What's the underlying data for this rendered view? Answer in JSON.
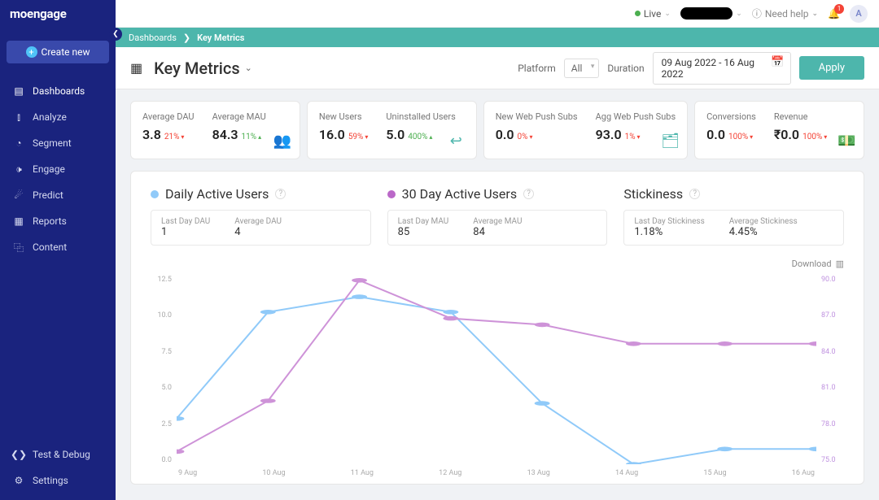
{
  "logo": "moengage",
  "create": "Create new",
  "nav": [
    {
      "icon": "▤",
      "label": "Dashboards"
    },
    {
      "icon": "⫾",
      "label": "Analyze"
    },
    {
      "icon": "◔",
      "label": "Segment"
    },
    {
      "icon": "🕩",
      "label": "Engage"
    },
    {
      "icon": "☄",
      "label": "Predict"
    },
    {
      "icon": "▦",
      "label": "Reports"
    },
    {
      "icon": "⿻",
      "label": "Content"
    }
  ],
  "nav_bottom": [
    {
      "icon": "❮❯",
      "label": "Test & Debug"
    },
    {
      "icon": "⚙",
      "label": "Settings"
    }
  ],
  "topbar": {
    "live": "Live",
    "help": "Need help",
    "badge": "1",
    "avatar": "A"
  },
  "breadcrumb": {
    "root": "Dashboards",
    "current": "Key Metrics"
  },
  "title": "Key Metrics",
  "filters": {
    "platform_label": "Platform",
    "platform_value": "All",
    "duration_label": "Duration",
    "date_range": "09 Aug 2022 - 16 Aug 2022",
    "apply": "Apply"
  },
  "kpi_cards": [
    {
      "type": "double",
      "icon": "👥",
      "groups": [
        {
          "label": "Average DAU",
          "value": "3.8",
          "change": "21%",
          "dir": "down"
        },
        {
          "label": "Average MAU",
          "value": "84.3",
          "change": "11%",
          "dir": "up"
        }
      ]
    },
    {
      "type": "double",
      "icon": "↩",
      "groups": [
        {
          "label": "New Users",
          "value": "16.0",
          "change": "59%",
          "dir": "down"
        },
        {
          "label": "Uninstalled Users",
          "value": "5.0",
          "change": "400%",
          "dir": "up"
        }
      ]
    },
    {
      "type": "double",
      "icon": "🗂",
      "groups": [
        {
          "label": "New Web Push Subs",
          "value": "0.0",
          "change": "0%",
          "dir": "down"
        },
        {
          "label": "Agg Web Push Subs",
          "value": "93.0",
          "change": "1%",
          "dir": "down"
        }
      ]
    },
    {
      "type": "double",
      "icon": "💵",
      "groups": [
        {
          "label": "Conversions",
          "value": "0.0",
          "change": "100%",
          "dir": "down"
        },
        {
          "label": "Revenue",
          "value": "₹0.0",
          "change": "100%",
          "dir": "down"
        }
      ]
    }
  ],
  "metrics": {
    "dau": {
      "title": "Daily Active Users",
      "subs": [
        {
          "label": "Last Day DAU",
          "value": "1"
        },
        {
          "label": "Average DAU",
          "value": "4"
        }
      ]
    },
    "mau": {
      "title": "30 Day Active Users",
      "subs": [
        {
          "label": "Last Day MAU",
          "value": "85"
        },
        {
          "label": "Average MAU",
          "value": "84"
        }
      ]
    },
    "stick": {
      "title": "Stickiness",
      "subs": [
        {
          "label": "Last Day Stickiness",
          "value": "1.18%"
        },
        {
          "label": "Average Stickiness",
          "value": "4.45%"
        }
      ]
    }
  },
  "download": "Download",
  "chart_data": {
    "type": "line",
    "categories": [
      "9 Aug",
      "10 Aug",
      "11 Aug",
      "12 Aug",
      "13 Aug",
      "14 Aug",
      "15 Aug",
      "16 Aug"
    ],
    "series": [
      {
        "name": "Daily Active Users",
        "axis": "left",
        "color": "#90caf9",
        "values": [
          3.0,
          10.0,
          11.0,
          10.0,
          4.0,
          0.0,
          1.0,
          1.0
        ]
      },
      {
        "name": "30 Day Active Users",
        "axis": "right",
        "color": "#ce93d8",
        "values": [
          76.0,
          80.0,
          89.5,
          86.5,
          86.0,
          84.5,
          84.5,
          84.5
        ]
      }
    ],
    "yleft": {
      "ticks": [
        "12.5",
        "10.0",
        "7.5",
        "5.0",
        "2.5",
        "0.0"
      ],
      "range": [
        0,
        12.5
      ]
    },
    "yright": {
      "ticks": [
        "90.0",
        "87.0",
        "84.0",
        "81.0",
        "78.0",
        "75.0"
      ],
      "range": [
        75,
        90
      ]
    }
  }
}
